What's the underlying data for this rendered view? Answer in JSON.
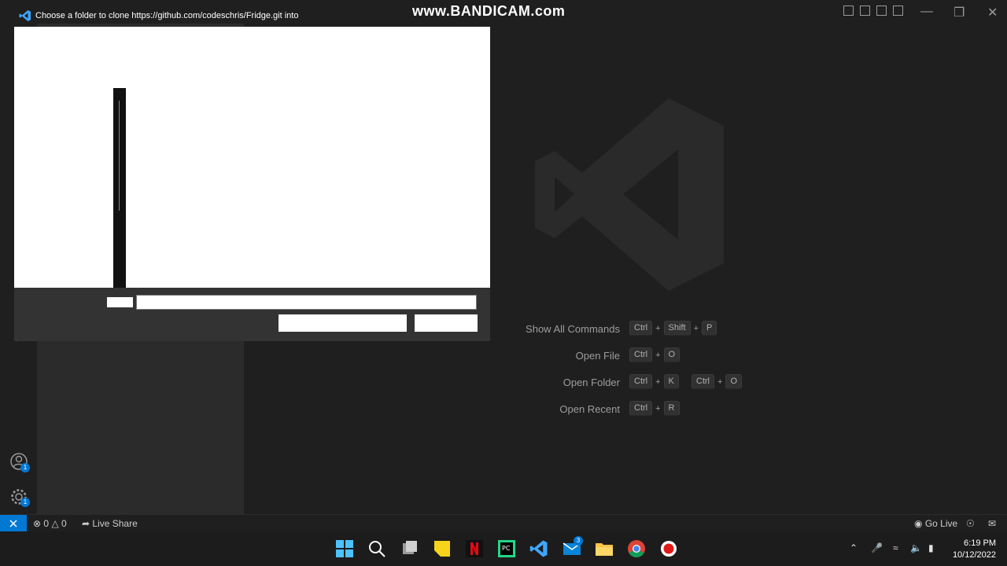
{
  "titlebar": {
    "dialog_title": "Choose a folder to clone https://github.com/codeschris/Fridge.git into",
    "watermark": "www.BANDICAM.com"
  },
  "welcome": {
    "shortcuts": [
      {
        "label": "Show All Commands",
        "keys": [
          [
            "Ctrl",
            "Shift",
            "P"
          ]
        ]
      },
      {
        "label": "Open File",
        "keys": [
          [
            "Ctrl",
            "O"
          ]
        ]
      },
      {
        "label": "Open Folder",
        "keys": [
          [
            "Ctrl",
            "K"
          ],
          [
            "Ctrl",
            "O"
          ]
        ]
      },
      {
        "label": "Open Recent",
        "keys": [
          [
            "Ctrl",
            "R"
          ]
        ]
      }
    ]
  },
  "statusbar": {
    "errors": "0",
    "warnings": "0",
    "live_share": "Live Share",
    "go_live": "Go Live"
  },
  "activitybar": {
    "accounts_badge": "1",
    "settings_badge": "1"
  },
  "taskbar": {
    "mail_badge": "3",
    "time": "6:19 PM",
    "date": "10/12/2022"
  },
  "colors": {
    "accent": "#0078d4",
    "background": "#1f1f1f",
    "sidebar": "#2b2b2b"
  },
  "icons": [
    "vscode-icon",
    "search-icon",
    "task-view-icon",
    "sticky-notes-icon",
    "netflix-icon",
    "pycharm-icon",
    "mail-icon",
    "file-explorer-icon",
    "chrome-icon",
    "record-icon",
    "chevron-up-icon",
    "microphone-icon",
    "wifi-icon",
    "volume-icon",
    "battery-icon"
  ]
}
